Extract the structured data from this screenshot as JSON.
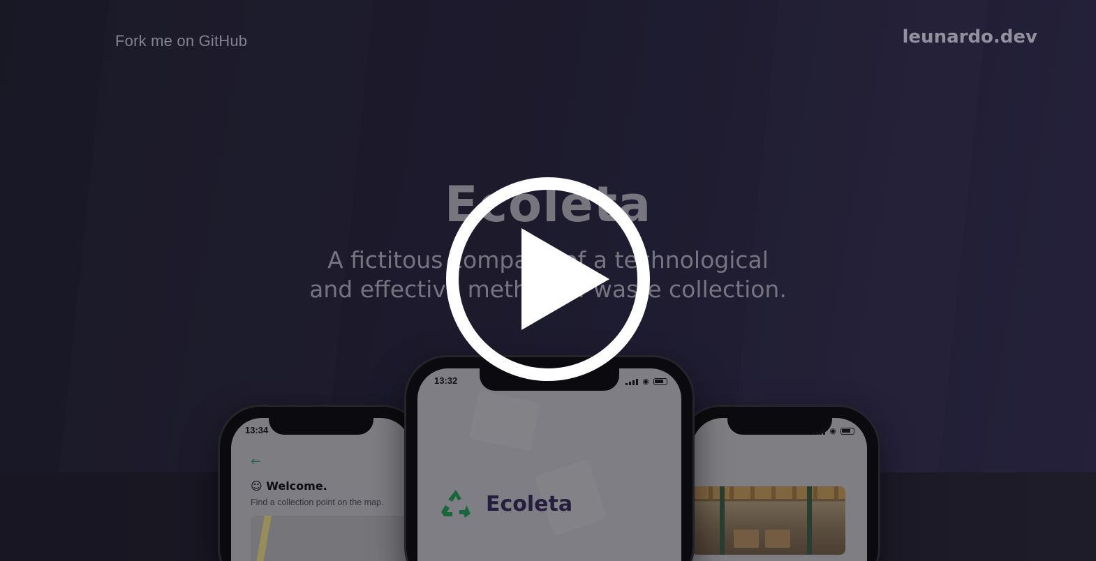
{
  "header": {
    "fork_link": "Fork me on GitHub",
    "brand": "leunardo.dev"
  },
  "hero": {
    "title": "Ecoleta",
    "subtitle_line1": "A fictitous company of a technological",
    "subtitle_line2": "and effective method of waste collection."
  },
  "phones": {
    "left": {
      "time": "13:34",
      "welcome": "Welcome.",
      "subtitle": "Find a collection point on the map."
    },
    "center": {
      "time": "13:32",
      "app_name": "Ecoleta"
    }
  },
  "video": {
    "play_icon": "play-icon"
  },
  "colors": {
    "background": "#1d1b2c",
    "accent_green": "#34cb79",
    "brand_dark": "#2a2346",
    "overlay_white": "#ffffff"
  }
}
